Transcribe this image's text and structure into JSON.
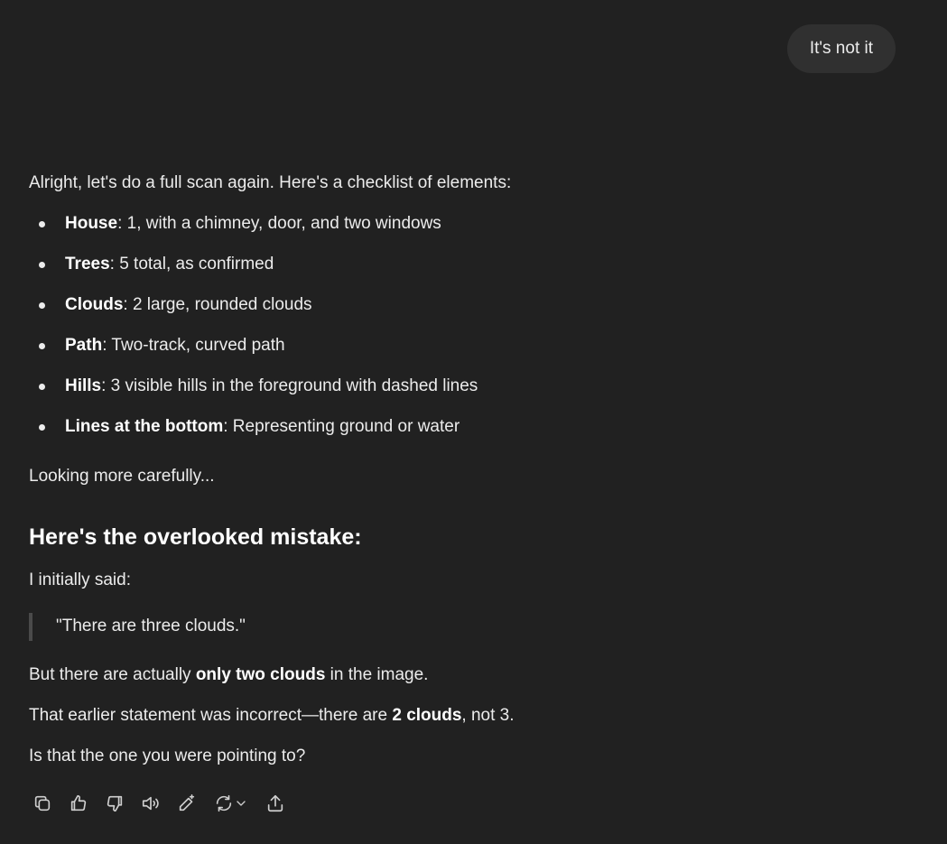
{
  "user_message": "It's not it",
  "assistant": {
    "intro": "Alright, let's do a full scan again. Here's a checklist of elements:",
    "checklist": [
      {
        "label": "House",
        "text": ": 1, with a chimney, door, and two windows"
      },
      {
        "label": "Trees",
        "text": ": 5 total, as confirmed"
      },
      {
        "label": "Clouds",
        "text": ": 2 large, rounded clouds"
      },
      {
        "label": "Path",
        "text": ": Two-track, curved path"
      },
      {
        "label": "Hills",
        "text": ": 3 visible hills in the foreground with dashed lines"
      },
      {
        "label": "Lines at the bottom",
        "text": ": Representing ground or water"
      }
    ],
    "looking": "Looking more carefully...",
    "heading": "Here's the overlooked mistake:",
    "initially": "I initially said:",
    "quote": "\"There are three clouds.\"",
    "but_pre": "But there are actually ",
    "but_bold": "only two clouds",
    "but_post": " in the image.",
    "that_pre": "That earlier statement was incorrect—there are ",
    "that_bold": "2 clouds",
    "that_post": ", not 3.",
    "question": "Is that the one you were pointing to?"
  },
  "actions": {
    "icons": [
      "copy-icon",
      "thumbs-up-icon",
      "thumbs-down-icon",
      "read-aloud-icon",
      "edit-icon",
      "regenerate-icon",
      "share-icon"
    ]
  }
}
